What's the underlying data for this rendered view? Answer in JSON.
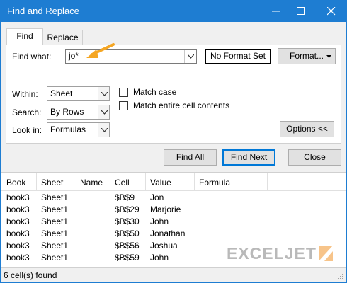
{
  "window": {
    "title": "Find and Replace"
  },
  "tabs": {
    "find": "Find",
    "replace": "Replace"
  },
  "find_what": {
    "label": "Find what:",
    "value": "jo*"
  },
  "format": {
    "no_format": "No Format Set",
    "button": "Format..."
  },
  "within": {
    "label": "Within:",
    "value": "Sheet"
  },
  "search": {
    "label": "Search:",
    "value": "By Rows"
  },
  "look_in": {
    "label": "Look in:",
    "value": "Formulas"
  },
  "options": {
    "match_case": "Match case",
    "match_entire": "Match entire cell contents",
    "options_button": "Options <<"
  },
  "buttons": {
    "find_all": "Find All",
    "find_next": "Find Next",
    "close": "Close"
  },
  "results": {
    "columns": [
      "Book",
      "Sheet",
      "Name",
      "Cell",
      "Value",
      "Formula"
    ],
    "rows": [
      [
        "book3",
        "Sheet1",
        "",
        "$B$9",
        "Jon",
        ""
      ],
      [
        "book3",
        "Sheet1",
        "",
        "$B$29",
        "Marjorie",
        ""
      ],
      [
        "book3",
        "Sheet1",
        "",
        "$B$30",
        "John",
        ""
      ],
      [
        "book3",
        "Sheet1",
        "",
        "$B$50",
        "Jonathan",
        ""
      ],
      [
        "book3",
        "Sheet1",
        "",
        "$B$56",
        "Joshua",
        ""
      ],
      [
        "book3",
        "Sheet1",
        "",
        "$B$59",
        "John",
        ""
      ]
    ]
  },
  "status": "6 cell(s) found",
  "logo": {
    "text": "EXCELJET"
  },
  "colors": {
    "titlebar": "#1e7dd2",
    "accent_arrow": "#f5a623",
    "default_button_border": "#0078d7",
    "logo_gray": "#b9b9b9"
  }
}
